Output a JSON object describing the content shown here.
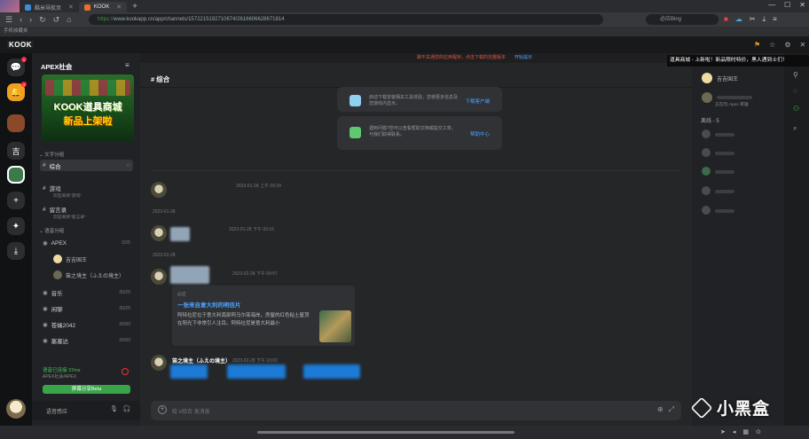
{
  "browser": {
    "tabs": [
      {
        "label": "酷米导航页"
      },
      {
        "label": "KOOK"
      }
    ],
    "new_tab": "+",
    "url_scheme": "https://",
    "url_rest": "www.kookapp.cn/app/channels/1572215192710674/2616606628671814",
    "search_placeholder": "必应Bing",
    "bookmark": "手机收藏夹",
    "window_controls": [
      "—",
      "☐",
      "✕"
    ]
  },
  "kook": {
    "logo": "KOOK",
    "notice": "聊不关通您的应用程序，点击下载的完整版本",
    "notice_link": "开始提示",
    "tooltip": "道具商城 - 上新啦！新品限时特价，黑人遇到士们！"
  },
  "servers": {
    "badges": [
      "1",
      "4"
    ],
    "text_server": "吉",
    "add": "+",
    "download": "⤓"
  },
  "guild": {
    "name": "APEX社会",
    "menu": "≡",
    "banner_line1": "KOOK道具商城",
    "banner_line2": "新品上架啦",
    "text_category": "文字分组",
    "channels": [
      {
        "name": "综合",
        "sub": ""
      },
      {
        "name": "游戏",
        "sub": "欢迎来到“游戏”"
      },
      {
        "name": "留言录",
        "sub": "欢迎来到“留言录”"
      }
    ],
    "voice_category": "语音分组",
    "voice_channels": [
      {
        "name": "APEX",
        "count": "02/5"
      },
      {
        "name": "音乐",
        "count": "00/25"
      },
      {
        "name": "闲聊",
        "count": "00/25"
      },
      {
        "name": "苍蝇2042",
        "count": "00/50"
      },
      {
        "name": "塞塞达",
        "count": "00/50"
      }
    ],
    "voice_members": [
      "吉吉国王",
      "笛之境主（ふえの境主）"
    ],
    "voice_status": "语音已连接 37ms",
    "voice_sub": "APEX社会/APEX",
    "share_button": "屏幕分享Beta",
    "user_status": "语音感应"
  },
  "chat": {
    "title": "综合",
    "cards": [
      {
        "text": "启动下载安装相关工具体验，您使更多信息及您游戏内显示。",
        "link": "下载客户端"
      },
      {
        "text": "遇到问题?您可以查看帮助文档或提交工单，与我们取得联系。",
        "link": "帮助中心"
      }
    ],
    "messages": [
      {
        "time": "2023-01-18 上午 09:34"
      },
      {
        "date": "2023-01-28",
        "time": "2023-01-28 下午 09:16"
      },
      {
        "date": "2023-02-28",
        "time": "2023-02-28 下午 09:57"
      }
    ],
    "embed": {
      "source": "必应",
      "title": "一张来自意大利的明信片",
      "desc": "阿特拉尼位于意大利南部阿马尔菲海岸，房屋的红色粘土屋顶在阳光下非常引人注目。阿特拉尼是意大利最小"
    },
    "last_author": "笛之境主（ふえの境主）",
    "last_time": "2023-02-28 下午 10:02",
    "composer_placeholder": "给 #综合 发消息"
  },
  "members": {
    "online": [
      {
        "name": "吉吉国王",
        "sub": ""
      },
      {
        "name": "",
        "sub": "正在玩 Apex 英雄"
      }
    ],
    "offline_header": "离线 - 5"
  },
  "watermark": "小黑盒"
}
